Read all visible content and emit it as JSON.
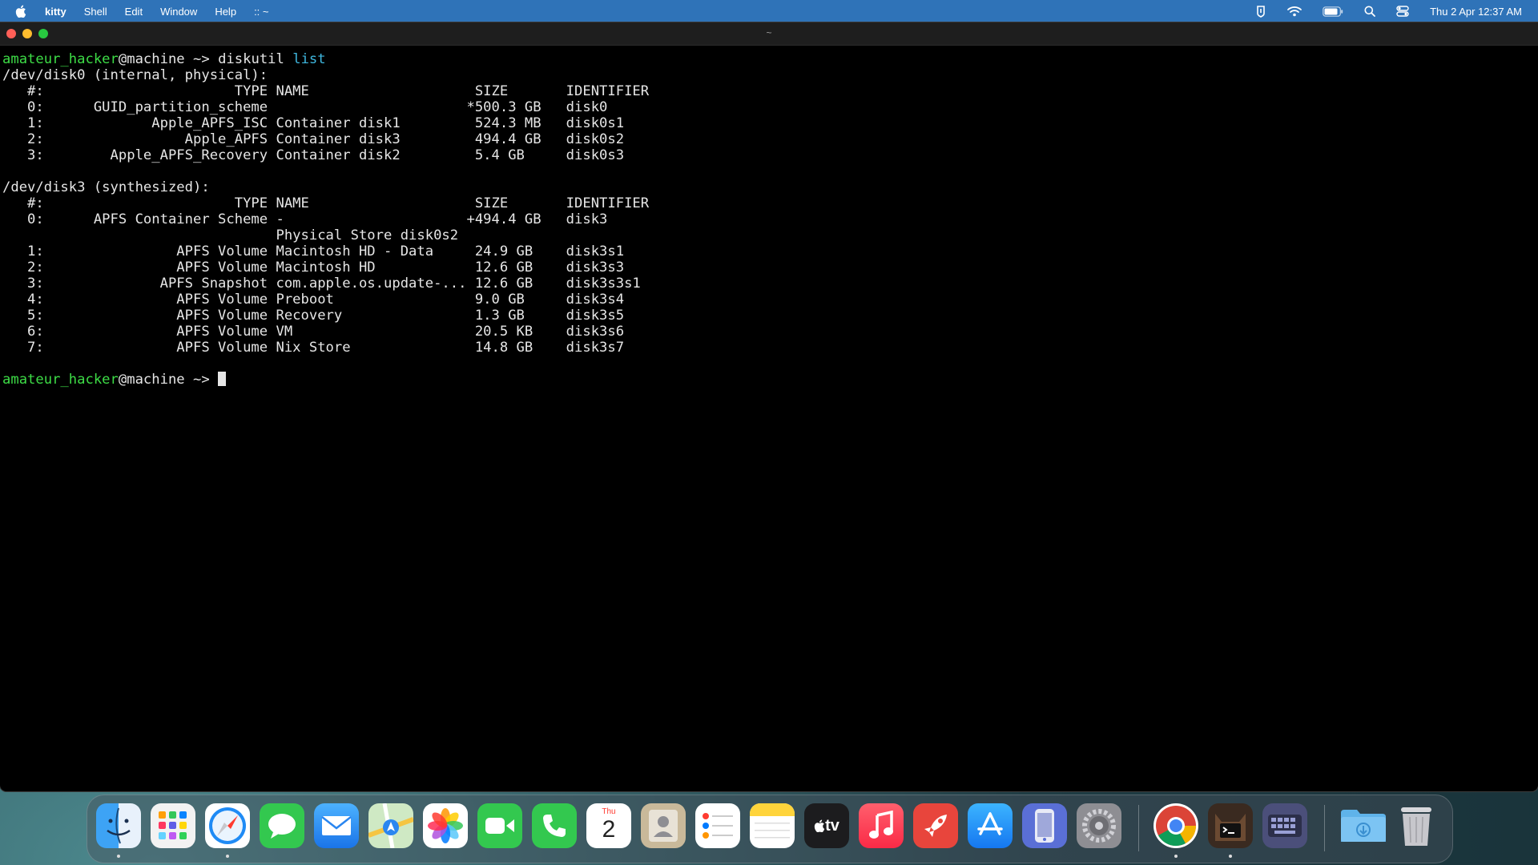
{
  "menubar": {
    "app_name": "kitty",
    "menus": [
      "Shell",
      "Edit",
      "Window",
      "Help",
      ":: ~"
    ],
    "clock": "Thu 2 Apr  12:37 AM"
  },
  "window": {
    "title": "~"
  },
  "terminal": {
    "prompt_user": "amateur_hacker",
    "prompt_host": "@machine",
    "prompt_dir": " ~> ",
    "command": "diskutil",
    "command_arg": "list",
    "lines": [
      "/dev/disk0 (internal, physical):",
      "   #:                       TYPE NAME                    SIZE       IDENTIFIER",
      "   0:      GUID_partition_scheme                        *500.3 GB   disk0",
      "   1:             Apple_APFS_ISC Container disk1         524.3 MB   disk0s1",
      "   2:                 Apple_APFS Container disk3         494.4 GB   disk0s2",
      "   3:        Apple_APFS_Recovery Container disk2         5.4 GB     disk0s3",
      "",
      "/dev/disk3 (synthesized):",
      "   #:                       TYPE NAME                    SIZE       IDENTIFIER",
      "   0:      APFS Container Scheme -                      +494.4 GB   disk3",
      "                                 Physical Store disk0s2",
      "   1:                APFS Volume Macintosh HD - Data     24.9 GB    disk3s1",
      "   2:                APFS Volume Macintosh HD            12.6 GB    disk3s3",
      "   3:              APFS Snapshot com.apple.os.update-... 12.6 GB    disk3s3s1",
      "   4:                APFS Volume Preboot                 9.0 GB     disk3s4",
      "   5:                APFS Volume Recovery                1.3 GB     disk3s5",
      "   6:                APFS Volume VM                      20.5 KB    disk3s6",
      "   7:                APFS Volume Nix Store               14.8 GB    disk3s7",
      ""
    ]
  },
  "dock": {
    "calendar_month": "Thu",
    "calendar_day": "2",
    "tv_label": "tv",
    "items": [
      "finder-icon",
      "launchpad-icon",
      "safari-icon",
      "messages-icon",
      "mail-icon",
      "maps-icon",
      "photos-icon",
      "facetime-icon",
      "phone-icon",
      "calendar-icon",
      "contacts-icon",
      "reminders-icon",
      "notes-icon",
      "apple-tv-icon",
      "music-icon",
      "rocket-icon",
      "app-store-icon",
      "simulator-icon",
      "system-settings-icon",
      "chrome-icon",
      "kitty-icon",
      "keyboard-viewer-icon",
      "downloads-folder-icon",
      "trash-icon"
    ]
  },
  "colors": {
    "menubar": "#2f73b8",
    "terminal_bg": "#000000",
    "prompt_user": "#3ddc46",
    "command_arg": "#3fb8e0"
  }
}
